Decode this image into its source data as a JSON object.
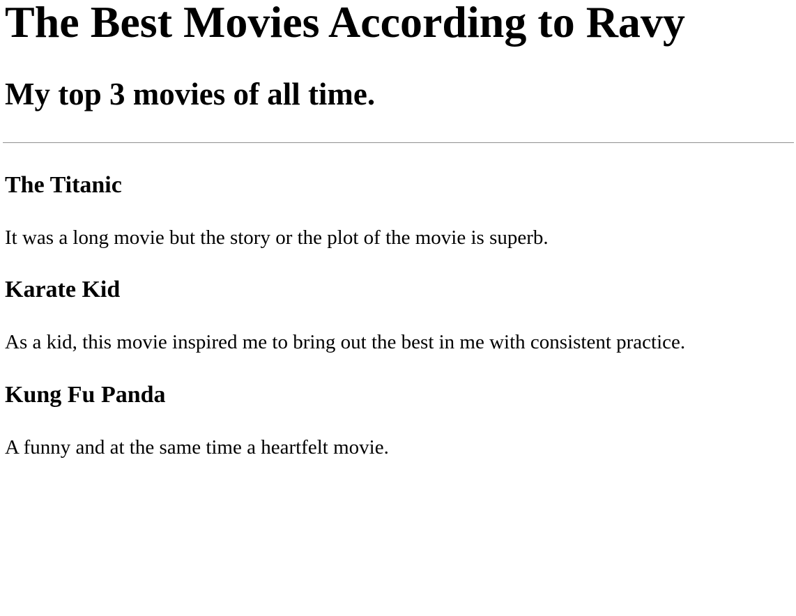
{
  "page": {
    "title": "The Best Movies According to Ravy",
    "subtitle": "My top 3 movies of all time."
  },
  "movies": [
    {
      "title": "The Titanic",
      "description": "It was a long movie but the story or the plot of the movie is superb."
    },
    {
      "title": "Karate Kid",
      "description": "As a kid, this movie inspired me to bring out the best in me with consistent practice."
    },
    {
      "title": "Kung Fu Panda",
      "description": "A funny and at the same time a heartfelt movie."
    }
  ]
}
